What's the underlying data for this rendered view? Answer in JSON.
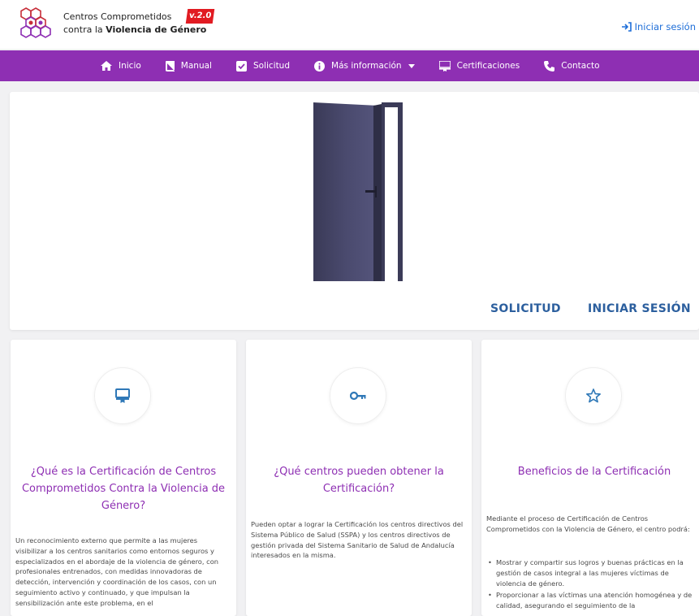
{
  "header": {
    "brand_line1": "Centros Comprometidos",
    "brand_line2_prefix": "contra la ",
    "brand_line2_bold": "Violencia de Género",
    "version": "v.2.0",
    "login_label": "Iniciar sesión"
  },
  "nav": {
    "items": [
      {
        "label": "Inicio",
        "icon": "home-icon"
      },
      {
        "label": "Manual",
        "icon": "book-icon"
      },
      {
        "label": "Solicitud",
        "icon": "checkbox-icon"
      },
      {
        "label": "Más información",
        "icon": "info-icon"
      },
      {
        "label": "Certificaciones",
        "icon": "certificate-icon"
      },
      {
        "label": "Contacto",
        "icon": "phone-icon"
      }
    ]
  },
  "hero": {
    "solicitud_label": "SOLICITUD",
    "login_label": "INICIAR SESIÓN"
  },
  "cards": [
    {
      "icon": "certificate-icon",
      "title": "¿Qué es la Certificación de Centros Comprometidos Contra la Violencia de Género?",
      "text": "Un reconocimiento externo que permite a las mujeres visibilizar a los centros sanitarios como entornos seguros y especializados en el abordaje de la violencia de género, con profesionales entrenados, con medidas innovadoras de detección, intervención y coordinación de los casos, con un seguimiento activo y continuado, y que impulsan la sensibilización ante este problema, en el"
    },
    {
      "icon": "key-icon",
      "title": "¿Qué centros pueden obtener la Certificación?",
      "text": "Pueden optar a lograr la Certificación los centros directivos del Sistema Público de Salud (SSPA) y los centros directivos de gestión privada del Sistema Sanitario de Salud de Andalucía interesados en la misma."
    },
    {
      "icon": "star-icon",
      "title": "Beneficios de la Certificación",
      "text": "Mediante el proceso de Certificación de Centros Comprometidos con la Violencia de Género, el centro podrá:",
      "bullets": [
        "Mostrar y compartir sus logros y buenas prácticas en la gestión de casos integral a las mujeres víctimas de violencia de género.",
        "Proporcionar a las víctimas una atención homogénea y de calidad, asegurando el seguimiento de la"
      ]
    }
  ],
  "colors": {
    "nav_bg": "#8e2fb3",
    "accent_title": "#8e2fb3",
    "hero_button": "#2c5f9e",
    "login_link": "#1e6ed8",
    "version_badge": "#e11b22",
    "icon_blue": "#2f78b7"
  }
}
